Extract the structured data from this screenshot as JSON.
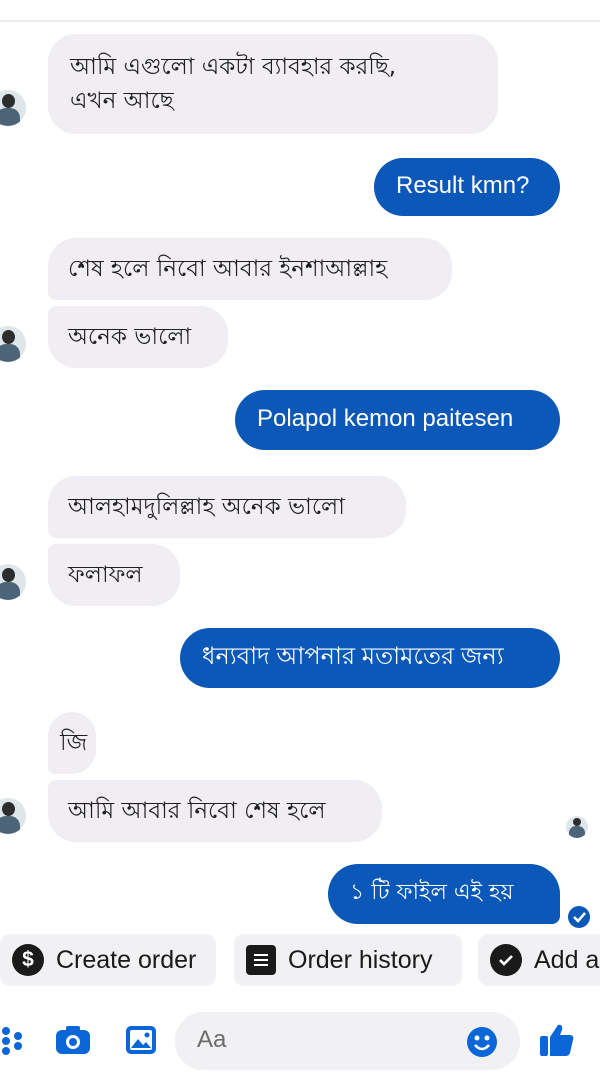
{
  "conversation": {
    "messages": [
      {
        "direction": "incoming",
        "text": "আমি এগুলো একটা ব্যাবহার করছি,"
      },
      {
        "direction": "incoming",
        "text": "এখন আছে"
      },
      {
        "direction": "outgoing",
        "text": "Result kmn?"
      },
      {
        "direction": "incoming",
        "text": "শেষ হলে নিবো আবার ইনশাআল্লাহ"
      },
      {
        "direction": "incoming",
        "text": "অনেক ভালো"
      },
      {
        "direction": "outgoing",
        "text": "Polapol kemon paitesen"
      },
      {
        "direction": "incoming",
        "text": "আলহামদুলিল্লাহ অনেক ভালো"
      },
      {
        "direction": "incoming",
        "text": "ফলাফল"
      },
      {
        "direction": "outgoing",
        "text": "ধন্যবাদ আপনার মতামতের জন্য"
      },
      {
        "direction": "incoming",
        "text": "জি"
      },
      {
        "direction": "incoming",
        "text": "আমি আবার নিবো শেষ হলে"
      },
      {
        "direction": "outgoing",
        "text": "১ টি ফাইল এই হয়"
      }
    ]
  },
  "quick_actions": [
    {
      "icon": "dollar-icon",
      "label": "Create order"
    },
    {
      "icon": "receipt-icon",
      "label": "Order history"
    },
    {
      "icon": "checkmark-icon",
      "label": "Add a"
    }
  ],
  "composer": {
    "placeholder": "Aa",
    "icons": [
      "more-dots-icon",
      "camera-icon",
      "gallery-icon",
      "emoji-icon",
      "thumbs-up-icon"
    ]
  },
  "colors": {
    "outgoing_bubble": "#0b58b8",
    "incoming_bubble": "#f0edf3",
    "accent": "#0b66d8"
  }
}
